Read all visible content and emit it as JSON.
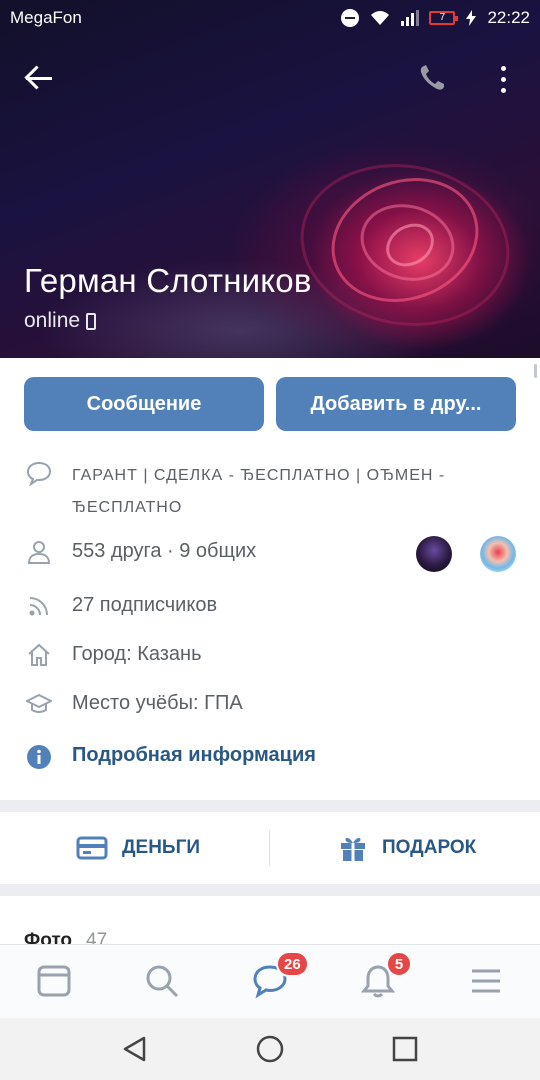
{
  "status_bar": {
    "carrier": "MegaFon",
    "battery": "7",
    "time": "22:22"
  },
  "profile": {
    "name": "Герман Слотников",
    "online": "online"
  },
  "buttons": {
    "message": "Сообщение",
    "add_friend": "Добавить в дру..."
  },
  "info": {
    "status_line1": "ГАРАНТ | СДЕЛКА - ЂЕСПЛАТНО | ОЂМЕН -",
    "status_line2": "ЂЕСПЛАТНО",
    "friends": "553 друга · 9 общих",
    "followers": "27 подписчиков",
    "city": "Город: Казань",
    "education": "Место учёбы: ГПА",
    "details_link": "Подробная информация"
  },
  "actions": {
    "money": "ДЕНЬГИ",
    "gift": "ПОДАРОК"
  },
  "photos": {
    "title": "Фото",
    "count": "47"
  },
  "bottom_nav": {
    "messages_badge": "26",
    "notifications_badge": "5"
  },
  "colors": {
    "accent": "#5181b8",
    "link": "#2a5885",
    "badge": "#e64646"
  }
}
